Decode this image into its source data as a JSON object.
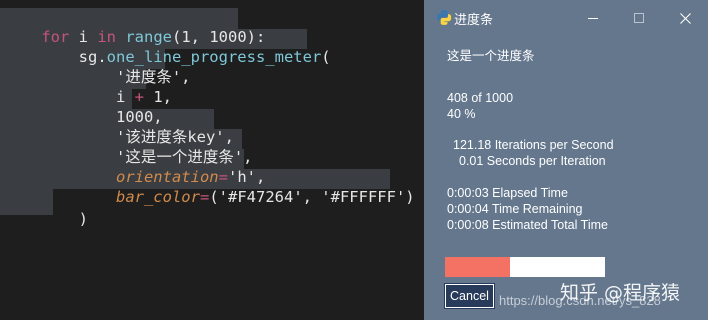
{
  "editor": {
    "line1": {
      "kw1": "for",
      "sp1": " i ",
      "kw2": "in",
      "fn": " range",
      "rest": "(1, 1000):"
    },
    "line2": {
      "indent": "    ",
      "obj": "sg.",
      "fn": "one_line_progress_meter",
      "rest": "("
    },
    "line3": {
      "indent": "        ",
      "text": "'进度条',"
    },
    "line4": {
      "indent": "        ",
      "a": "i ",
      "op": "+",
      "b": " 1,"
    },
    "line5": {
      "indent": "        ",
      "text": "1000,"
    },
    "line6": {
      "indent": "        ",
      "text": "'该进度条key',"
    },
    "line7": {
      "indent": "        ",
      "text": "'这是一个进度条',"
    },
    "line8": {
      "indent": "        ",
      "param": "orientation",
      "op": "=",
      "rest": "'h',"
    },
    "line9": {
      "indent": "        ",
      "param": "bar_color",
      "op": "=",
      "rest": "('#F47264', '#FFFFFF')"
    },
    "line10": {
      "indent": "    ",
      "text": ")"
    }
  },
  "window": {
    "title": "进度条",
    "message": "这是一个进度条",
    "count": "408 of 1000",
    "percent": "40 %",
    "rate": "121.18 Iterations per Second",
    "sec_per_iter": "0.01 Seconds per Iteration",
    "elapsed": "0:00:03 Elapsed Time",
    "remaining": "0:00:04 Time Remaining",
    "total": "0:00:08 Estimated Total Time",
    "progress_fraction": 0.408,
    "bar_color": "#F47264",
    "bar_bg": "#FFFFFF",
    "cancel_label": "Cancel",
    "minimize_icon": "minimize-icon",
    "maximize_icon": "maximize-icon",
    "close_icon": "close-icon"
  },
  "watermark": {
    "zh": "知乎 @程序猿",
    "url": "https://blog.csdn.net/ys_828"
  }
}
